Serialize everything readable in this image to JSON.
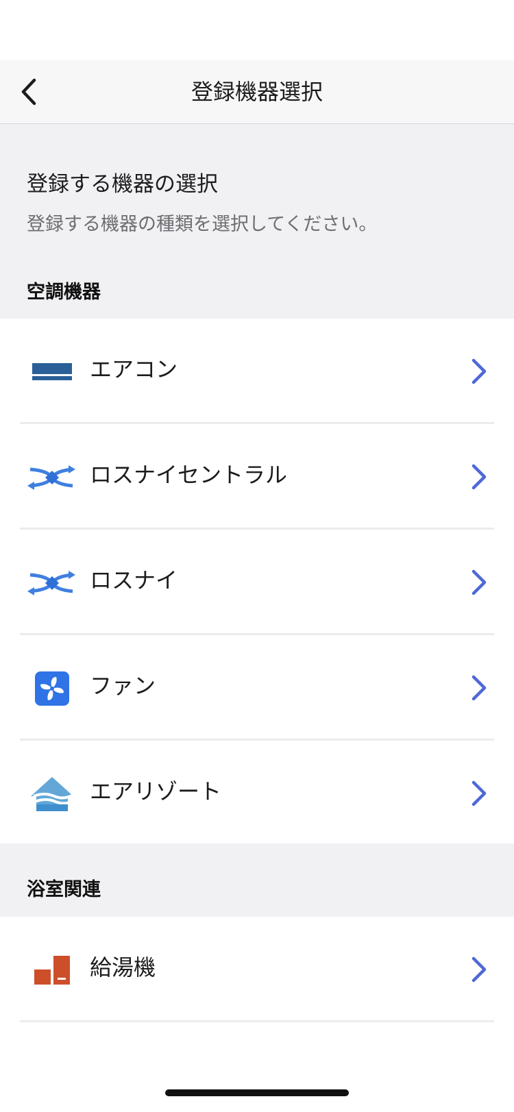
{
  "nav": {
    "title": "登録機器選択",
    "back_icon": "chevron-left-icon"
  },
  "intro": {
    "title": "登録する機器の選択",
    "description": "登録する機器の種類を選択してください。"
  },
  "sections": [
    {
      "header": "空調機器",
      "items": [
        {
          "label": "エアコン",
          "icon": "air-conditioner-icon"
        },
        {
          "label": "ロスナイセントラル",
          "icon": "lossnay-central-icon"
        },
        {
          "label": "ロスナイ",
          "icon": "lossnay-icon"
        },
        {
          "label": "ファン",
          "icon": "fan-icon"
        },
        {
          "label": "エアリゾート",
          "icon": "air-resort-icon"
        }
      ]
    },
    {
      "header": "浴室関連",
      "items": [
        {
          "label": "給湯機",
          "icon": "water-heater-icon"
        }
      ]
    }
  ],
  "colors": {
    "chevron": "#4f68d8",
    "background": "#f1f1f3",
    "list_background": "#ffffff",
    "aircon_blue": "#2a5f97",
    "lossnay_blue": "#3f7fe0",
    "fan_blue": "#2f73e6",
    "resort_blue": "#4a9bd8",
    "heater_orange": "#cc4f2a"
  }
}
